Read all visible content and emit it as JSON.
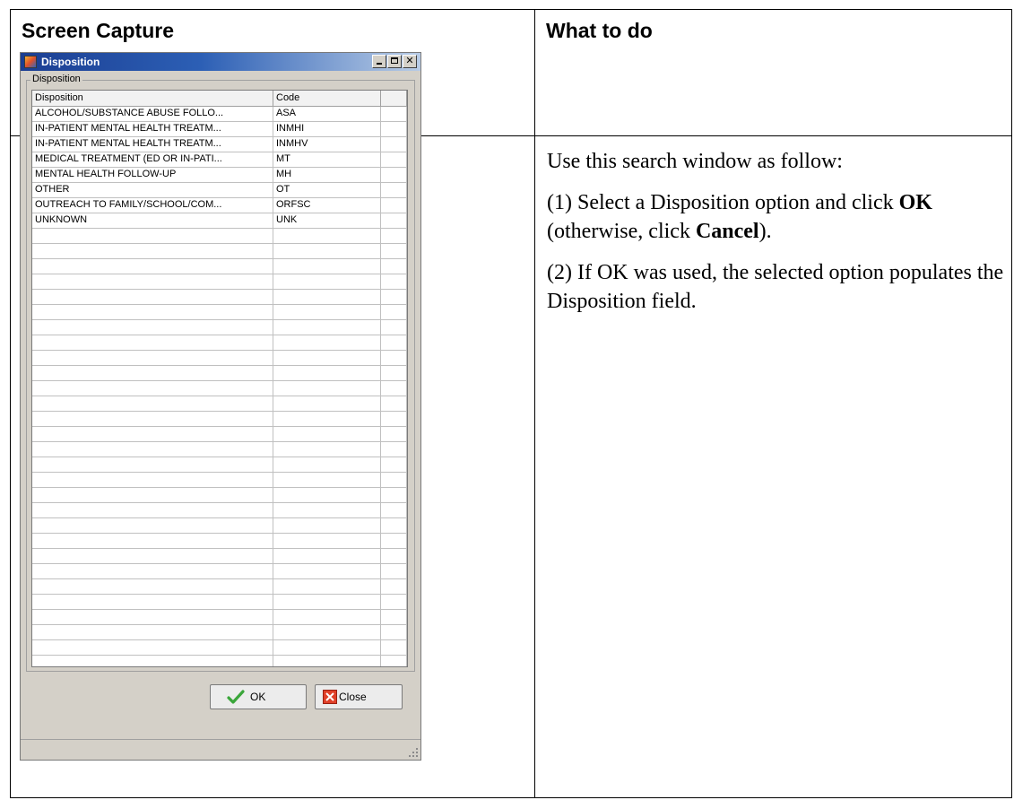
{
  "table": {
    "header_left": "Screen Capture",
    "header_right": "What to do"
  },
  "instructions": {
    "intro": "Use this search window as follow:",
    "step1": {
      "prefix": "(1) Select a Disposition option and click ",
      "ok": "OK",
      "middle": " (otherwise, click ",
      "cancel": "Cancel",
      "suffix": ")."
    },
    "step2": "(2) If OK was used, the selected option populates the Disposition field."
  },
  "dialog": {
    "title": "Disposition",
    "group_label": "Disposition",
    "columns": [
      "Disposition",
      "Code"
    ],
    "rows": [
      {
        "disposition": "ALCOHOL/SUBSTANCE ABUSE FOLLO...",
        "code": "ASA"
      },
      {
        "disposition": "IN-PATIENT MENTAL HEALTH TREATM...",
        "code": "INMHI"
      },
      {
        "disposition": "IN-PATIENT MENTAL HEALTH TREATM...",
        "code": "INMHV"
      },
      {
        "disposition": "MEDICAL TREATMENT (ED OR IN-PATI...",
        "code": "MT"
      },
      {
        "disposition": "MENTAL HEALTH FOLLOW-UP",
        "code": "MH"
      },
      {
        "disposition": "OTHER",
        "code": "OT"
      },
      {
        "disposition": "OUTREACH TO FAMILY/SCHOOL/COM...",
        "code": "ORFSC"
      },
      {
        "disposition": "UNKNOWN",
        "code": "UNK"
      }
    ],
    "ok_label": "OK",
    "close_label": "Close",
    "icons": {
      "app": "app-icon",
      "minimize": "minimize-icon",
      "maximize": "maximize-icon",
      "close": "close-icon",
      "ok": "checkmark-icon",
      "cancel": "x-icon",
      "grip": "resize-grip-icon"
    }
  }
}
